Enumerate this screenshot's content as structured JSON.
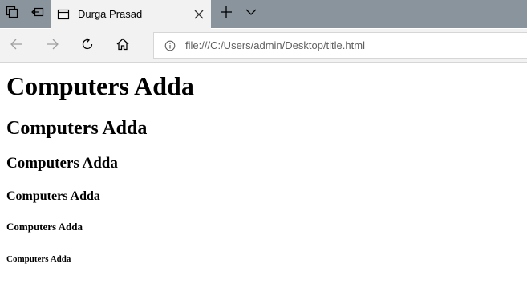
{
  "browser": {
    "tab": {
      "title": "Durga Prasad"
    },
    "address_bar": {
      "url": "file:///C:/Users/admin/Desktop/title.html"
    },
    "icons": {
      "tab_actions": "tab-actions-icon",
      "set_tabs_aside": "set-tabs-aside-icon",
      "page": "page-icon",
      "close": "close-icon",
      "new_tab": "plus-icon",
      "tab_list": "chevron-down-icon",
      "back": "back-arrow-icon",
      "forward": "forward-arrow-icon",
      "refresh": "refresh-icon",
      "home": "home-icon",
      "info": "info-icon"
    },
    "colors": {
      "titlebar": "#8a949c",
      "tab_active": "#f2f2f2",
      "page_background": "#ffffff"
    }
  },
  "page": {
    "h1": "Computers Adda",
    "h2": "Computers Adda",
    "h3": "Computers Adda",
    "h4": "Computers Adda",
    "h5": "Computers Adda",
    "h6": "Computers Adda"
  }
}
